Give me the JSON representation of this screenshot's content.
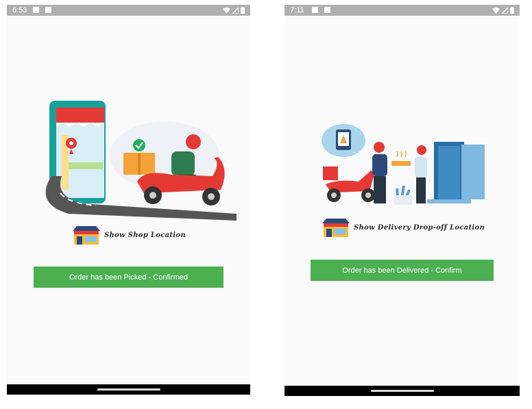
{
  "colors": {
    "accent": "#4caf50",
    "status_bar": "#b0b0b0",
    "nav_bar": "#000000"
  },
  "screens": [
    {
      "status": {
        "time": "6:53"
      },
      "illustration": "delivery-scooter-pickup-illustration",
      "location_link": {
        "icon": "shop-icon",
        "label": "Show Shop Location"
      },
      "action_button": {
        "label": "Order has been Picked - Confirmed"
      }
    },
    {
      "status": {
        "time": "7:11"
      },
      "illustration": "delivery-handoff-illustration",
      "location_link": {
        "icon": "shop-icon",
        "label": "Show Delivery Drop-off Location"
      },
      "action_button": {
        "label": "Order has been Delivered - Confirm"
      }
    }
  ]
}
